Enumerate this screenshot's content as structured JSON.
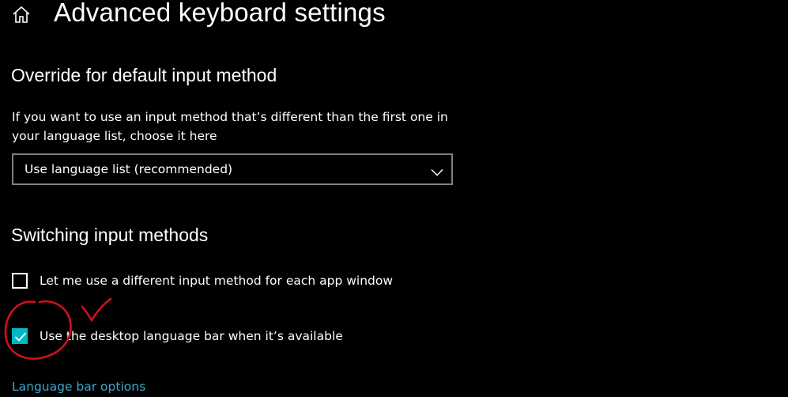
{
  "header": {
    "home_icon": "home-icon",
    "title": "Advanced keyboard settings"
  },
  "override_section": {
    "heading": "Override for default input method",
    "description": "If you want to use an input method that’s different than the first one in your language list, choose it here",
    "dropdown": {
      "selected": "Use language list (recommended)",
      "icon": "chevron-down-icon"
    }
  },
  "switching_section": {
    "heading": "Switching input methods",
    "options": [
      {
        "label": "Let me use a different input method for each app window",
        "checked": false
      },
      {
        "label": "Use the desktop language bar when it’s available",
        "checked": true
      }
    ],
    "link": "Language bar options"
  },
  "colors": {
    "background": "#000000",
    "text": "#ffffff",
    "accent": "#00b7c3",
    "link": "#3ea6c8",
    "dropdown_border": "#808080",
    "annotation": "#d0101c"
  }
}
